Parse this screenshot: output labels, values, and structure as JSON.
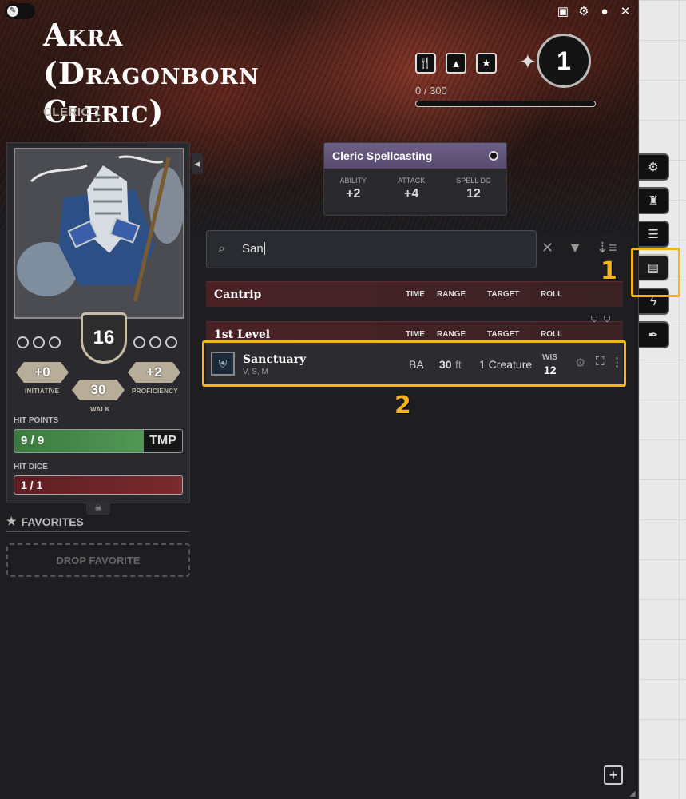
{
  "header": {
    "name_line1": "Akra (Dragonborn",
    "name_line2": "Cleric)",
    "class_level": "CLERIC 1",
    "xp": "0 / 300",
    "level": "1"
  },
  "window_icons": [
    "journal-icon",
    "gear-icon",
    "user-icon",
    "close-icon"
  ],
  "rest_icons": [
    "short-rest-icon",
    "long-rest-icon",
    "inspiration-icon"
  ],
  "stats": {
    "armor_class": "16",
    "initiative_value": "+0",
    "initiative_label": "INITIATIVE",
    "walk_value": "30",
    "walk_label": "WALK",
    "proficiency_value": "+2",
    "proficiency_label": "PROFICIENCY",
    "hp_label": "HIT POINTS",
    "hp_value": "9 / 9",
    "tmp_label": "TMP",
    "hit_dice_label": "HIT DICE",
    "hit_dice_value": "1 / 1"
  },
  "favorites": {
    "title": "FAVORITES",
    "drop_label": "DROP FAVORITE"
  },
  "spellcasting": {
    "title": "Cleric Spellcasting",
    "ability_label": "ABILITY",
    "ability_value": "+2",
    "attack_label": "ATTACK",
    "attack_value": "+4",
    "dc_label": "SPELL DC",
    "dc_value": "12"
  },
  "search": {
    "value": "San"
  },
  "columns": {
    "time": "TIME",
    "range": "RANGE",
    "target": "TARGET",
    "roll": "ROLL"
  },
  "sections": {
    "cantrip": "Cantrip",
    "first_level": "1st Level"
  },
  "spell": {
    "name": "Sanctuary",
    "components": "V, S, M",
    "time": "BA",
    "range_value": "30",
    "range_unit": "ft",
    "target": "1 Creature",
    "save_label": "WIS",
    "save_value": "12"
  },
  "annotations": {
    "label_1": "1",
    "label_2": "2",
    "color": "#f3b518"
  },
  "right_tabs": [
    "attributes-tab",
    "inventory-tab",
    "features-tab",
    "spells-tab",
    "effects-tab",
    "biography-tab"
  ]
}
